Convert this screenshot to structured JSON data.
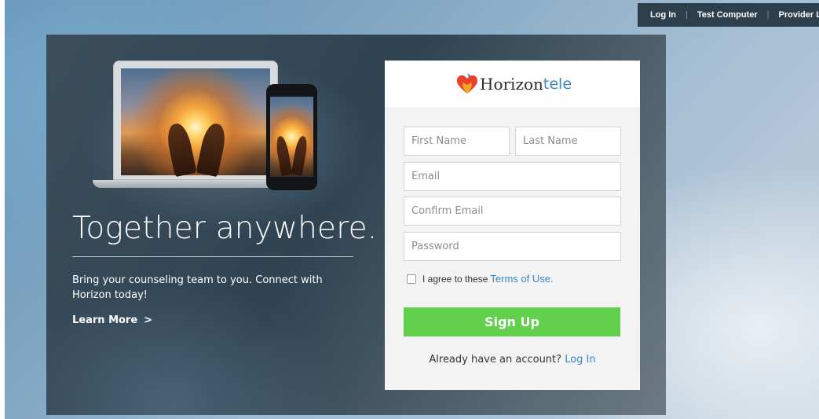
{
  "topbar": {
    "login": "Log In",
    "test_computer": "Test Computer",
    "provider_login": "Provider Login",
    "separator": "|"
  },
  "hero": {
    "headline": "Together anywhere.",
    "subtext": "Bring your counseling team to you. Connect with Horizon today!",
    "learn_more": "Learn More",
    "learn_more_arrow": ">"
  },
  "logo": {
    "name_part1": "Horizon",
    "name_part2": "tele",
    "icon": "heart-signal-icon"
  },
  "form": {
    "first_name_placeholder": "First Name",
    "last_name_placeholder": "Last Name",
    "email_placeholder": "Email",
    "confirm_email_placeholder": "Confirm Email",
    "password_placeholder": "Password",
    "agree_text": "I agree to these",
    "terms_link": "Terms of Use.",
    "terms_checked": false,
    "signup_button": "Sign Up",
    "already_text": "Already have an account?",
    "login_link": "Log In"
  },
  "colors": {
    "topbar_bg": "#2d3e4c",
    "signup_green": "#62cf4d",
    "link_blue": "#3a87c6",
    "heart_red": "#e8412c",
    "heart_orange": "#f6a623"
  }
}
